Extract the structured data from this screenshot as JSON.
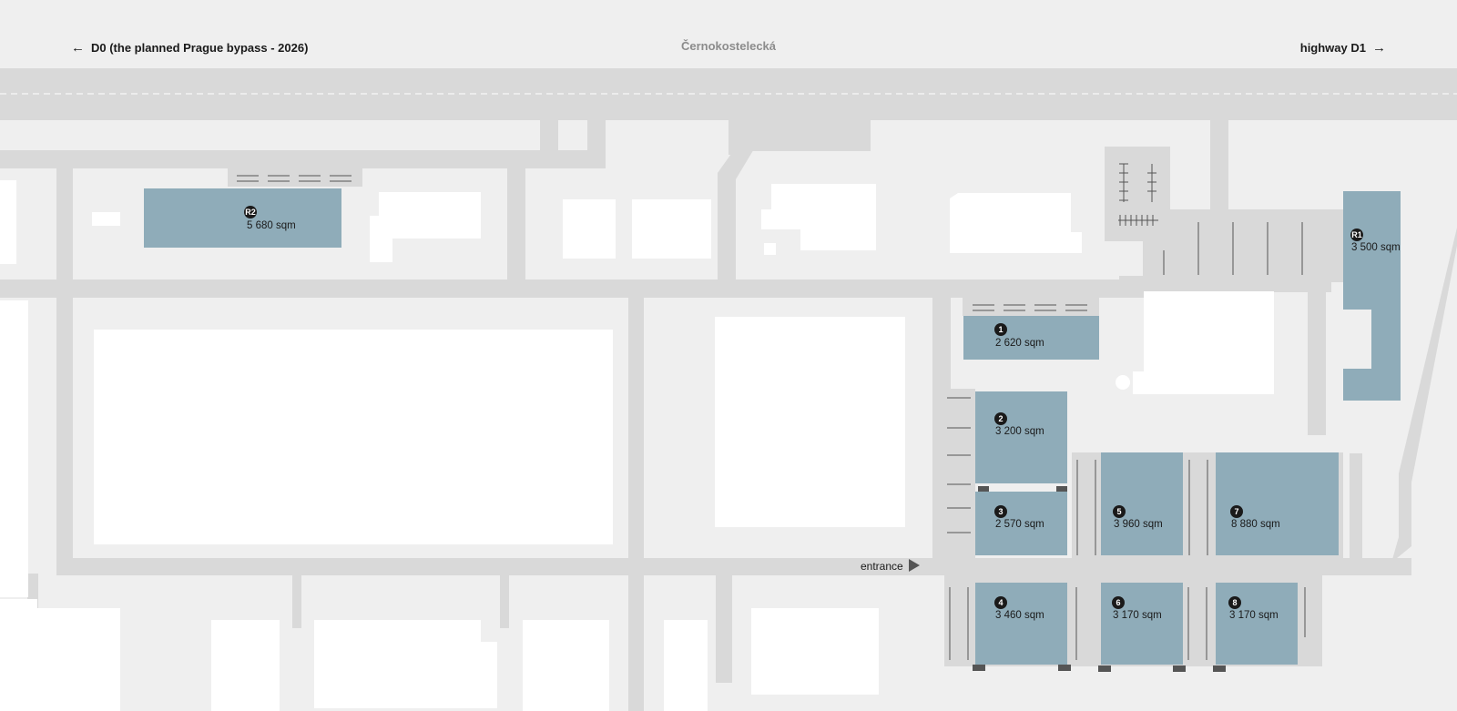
{
  "header": {
    "left_link": {
      "label": "D0 (the planned Prague bypass - 2026)",
      "icon": "arrow-left-icon"
    },
    "center_label": "Černokostelecká",
    "right_link": {
      "label": "highway D1",
      "icon": "arrow-right-icon"
    }
  },
  "map": {
    "entrance_label": "entrance",
    "units": [
      {
        "id": "R2",
        "area": "5 680 sqm"
      },
      {
        "id": "R1",
        "area": "3 500 sqm"
      },
      {
        "id": "1",
        "area": "2 620 sqm"
      },
      {
        "id": "2",
        "area": "3 200 sqm"
      },
      {
        "id": "3",
        "area": "2 570 sqm"
      },
      {
        "id": "5",
        "area": "3 960 sqm"
      },
      {
        "id": "7",
        "area": "8 880 sqm"
      },
      {
        "id": "4",
        "area": "3 460 sqm"
      },
      {
        "id": "6",
        "area": "3 170 sqm"
      },
      {
        "id": "8",
        "area": "3 170 sqm"
      }
    ]
  },
  "colors": {
    "background": "#efefef",
    "road": "#d9d9d9",
    "building": "#ffffff",
    "unit": "#8facb9",
    "badge": "#1a1a1a",
    "parking_line": "#555555"
  }
}
